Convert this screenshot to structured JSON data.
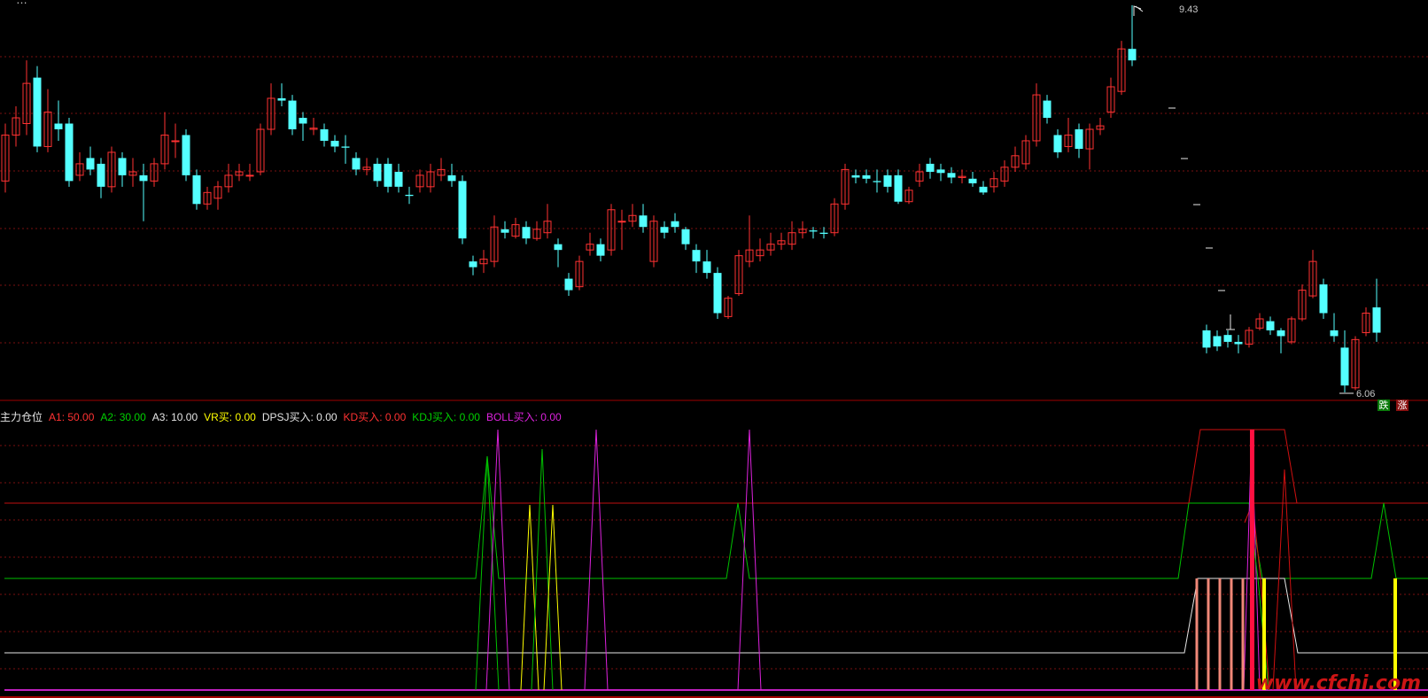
{
  "app": {
    "top_title_fragment": "…"
  },
  "price_panel": {
    "high_label": "9.43",
    "low_label": "6.06",
    "badge_down": "跌",
    "badge_up": "涨",
    "colors": {
      "up": "#ff3232",
      "down": "#54ffff",
      "grid": "#7a1010",
      "border": "#a00000",
      "ghost": "#e8e8e8"
    }
  },
  "indicator": {
    "name": "主力仓位",
    "items": [
      {
        "label": "A1:",
        "value": "50.00",
        "color": "#ff3232"
      },
      {
        "label": "A2:",
        "value": "30.00",
        "color": "#00d000"
      },
      {
        "label": "A3:",
        "value": "10.00",
        "color": "#e6e6e6"
      },
      {
        "label": "VR买:",
        "value": "0.00",
        "color": "#ffff00"
      },
      {
        "label": "DPSJ买入:",
        "value": "0.00",
        "color": "#e6e6e6"
      },
      {
        "label": "KD买入:",
        "value": "0.00",
        "color": "#ff3232"
      },
      {
        "label": "KDJ买入:",
        "value": "0.00",
        "color": "#00d000"
      },
      {
        "label": "BOLL买入:",
        "value": "0.00",
        "color": "#dd22dd"
      }
    ]
  },
  "watermark": "www.cfchi.com"
}
